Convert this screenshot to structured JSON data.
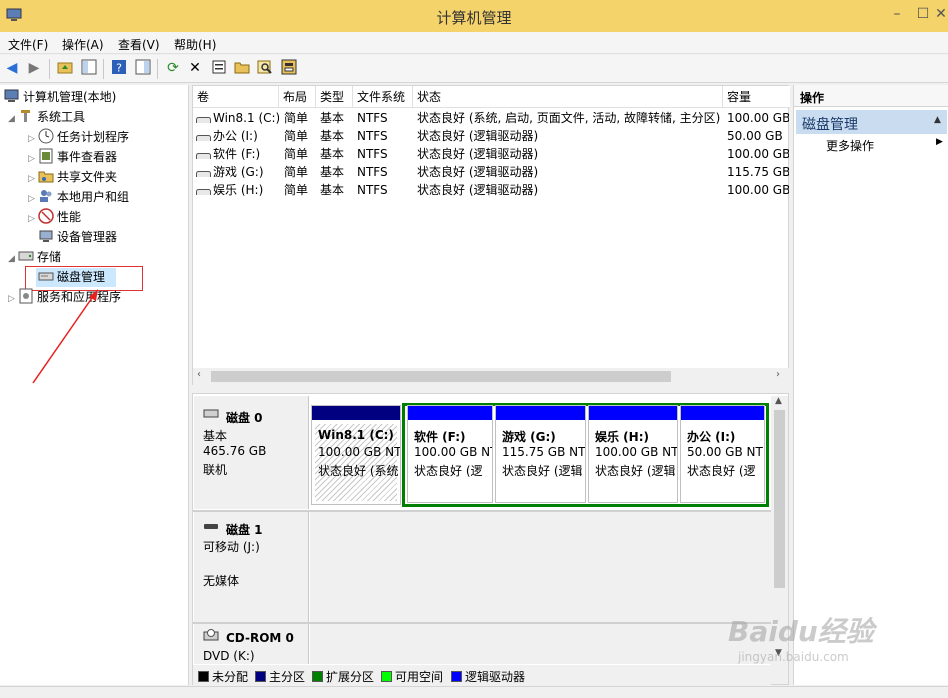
{
  "window": {
    "title": "计算机管理"
  },
  "menu": [
    "文件(F)",
    "操作(A)",
    "查看(V)",
    "帮助(H)"
  ],
  "tree": {
    "root": "计算机管理(本地)",
    "system_tools": "系统工具",
    "task_scheduler": "任务计划程序",
    "event_viewer": "事件查看器",
    "shared_folders": "共享文件夹",
    "local_users": "本地用户和组",
    "performance": "性能",
    "device_manager": "设备管理器",
    "storage": "存储",
    "disk_management": "磁盘管理",
    "services_apps": "服务和应用程序"
  },
  "table": {
    "headers": [
      "卷",
      "布局",
      "类型",
      "文件系统",
      "状态",
      "容量"
    ],
    "rows": [
      [
        "Win8.1 (C:)",
        "简单",
        "基本",
        "NTFS",
        "状态良好 (系统, 启动, 页面文件, 活动, 故障转储, 主分区)",
        "100.00 GB"
      ],
      [
        "办公 (I:)",
        "简单",
        "基本",
        "NTFS",
        "状态良好 (逻辑驱动器)",
        "50.00 GB"
      ],
      [
        "软件 (F:)",
        "简单",
        "基本",
        "NTFS",
        "状态良好 (逻辑驱动器)",
        "100.00 GB"
      ],
      [
        "游戏 (G:)",
        "简单",
        "基本",
        "NTFS",
        "状态良好 (逻辑驱动器)",
        "115.75 GB"
      ],
      [
        "娱乐 (H:)",
        "简单",
        "基本",
        "NTFS",
        "状态良好 (逻辑驱动器)",
        "100.00 GB"
      ]
    ]
  },
  "disks": {
    "disk0": {
      "name": "磁盘 0",
      "type": "基本",
      "size": "465.76 GB",
      "state": "联机"
    },
    "disk1": {
      "name": "磁盘 1",
      "type": "可移动 (J:)",
      "media": "无媒体"
    },
    "cdrom": {
      "name": "CD-ROM 0",
      "type": "DVD (K:)"
    }
  },
  "partitions": [
    {
      "name": "Win8.1  (C:)",
      "size": "100.00 GB NT",
      "status": "状态良好 (系统"
    },
    {
      "name": "软件  (F:)",
      "size": "100.00 GB NT",
      "status": "状态良好 (逻"
    },
    {
      "name": "游戏  (G:)",
      "size": "115.75 GB NT",
      "status": "状态良好 (逻辑"
    },
    {
      "name": "娱乐  (H:)",
      "size": "100.00 GB NT",
      "status": "状态良好 (逻辑"
    },
    {
      "name": "办公  (I:)",
      "size": "50.00 GB NT",
      "status": "状态良好 (逻"
    }
  ],
  "legend": [
    {
      "label": "未分配",
      "color": "#000000"
    },
    {
      "label": "主分区",
      "color": "#000080"
    },
    {
      "label": "扩展分区",
      "color": "#008000"
    },
    {
      "label": "可用空间",
      "color": "#00ff00"
    },
    {
      "label": "逻辑驱动器",
      "color": "#0000ff"
    }
  ],
  "actions": {
    "header": "操作",
    "section": "磁盘管理",
    "more": "更多操作"
  },
  "colors": {
    "titlebar": "#f4d36b",
    "primary_partition": "#000080",
    "logical_drive": "#0000ff",
    "extended_partition": "#008000",
    "selection_box": "#e03232"
  },
  "icons": [
    "back-icon",
    "forward-icon",
    "up-folder-icon",
    "show-tree-icon",
    "help-icon",
    "properties-pane-icon",
    "refresh-icon",
    "delete-icon",
    "properties-icon",
    "open-folder-icon",
    "search-icon",
    "disk-settings-icon"
  ],
  "watermark": {
    "text": "Baidu经验",
    "sub": "jingyan.baidu.com"
  }
}
